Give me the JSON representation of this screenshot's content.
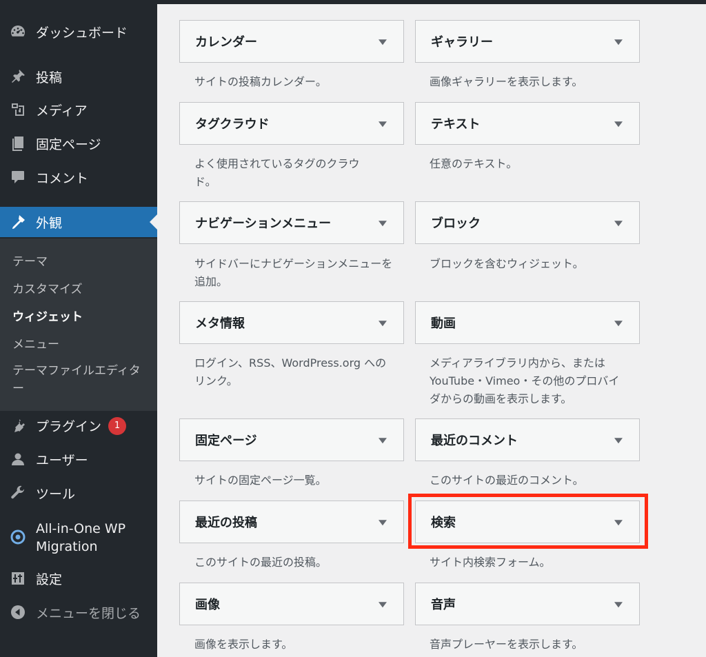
{
  "sidebar": {
    "items": [
      {
        "label": "ダッシュボード",
        "icon": "dashboard-icon"
      },
      {
        "label": "投稿",
        "icon": "pin-icon"
      },
      {
        "label": "メディア",
        "icon": "media-icon"
      },
      {
        "label": "固定ページ",
        "icon": "page-icon"
      },
      {
        "label": "コメント",
        "icon": "comment-icon"
      },
      {
        "label": "外観",
        "icon": "appearance-icon"
      },
      {
        "label": "プラグイン",
        "icon": "plugin-icon",
        "badge": "1"
      },
      {
        "label": "ユーザー",
        "icon": "user-icon"
      },
      {
        "label": "ツール",
        "icon": "wrench-icon"
      },
      {
        "label": "All-in-One WP Migration",
        "icon": "migration-icon"
      },
      {
        "label": "設定",
        "icon": "settings-icon"
      },
      {
        "label": "メニューを閉じる",
        "icon": "collapse-icon"
      }
    ],
    "submenu": [
      {
        "label": "テーマ"
      },
      {
        "label": "カスタマイズ"
      },
      {
        "label": "ウィジェット"
      },
      {
        "label": "メニュー"
      },
      {
        "label": "テーマファイルエディター"
      }
    ]
  },
  "widgets": [
    {
      "title": "カレンダー",
      "desc": "サイトの投稿カレンダー。"
    },
    {
      "title": "ギャラリー",
      "desc": "画像ギャラリーを表示します。"
    },
    {
      "title": "タグクラウド",
      "desc": "よく使用されているタグのクラウド。"
    },
    {
      "title": "テキスト",
      "desc": "任意のテキスト。"
    },
    {
      "title": "ナビゲーションメニュー",
      "desc": "サイドバーにナビゲーションメニューを追加。"
    },
    {
      "title": "ブロック",
      "desc": "ブロックを含むウィジェット。"
    },
    {
      "title": "メタ情報",
      "desc": "ログイン、RSS、WordPress.org へのリンク。"
    },
    {
      "title": "動画",
      "desc": "メディアライブラリ内から、または YouTube・Vimeo・その他のプロバイダからの動画を表示します。"
    },
    {
      "title": "固定ページ",
      "desc": "サイトの固定ページ一覧。"
    },
    {
      "title": "最近のコメント",
      "desc": "このサイトの最近のコメント。"
    },
    {
      "title": "最近の投稿",
      "desc": "このサイトの最近の投稿。"
    },
    {
      "title": "検索",
      "desc": "サイト内検索フォーム。"
    },
    {
      "title": "画像",
      "desc": "画像を表示します。"
    },
    {
      "title": "音声",
      "desc": "音声プレーヤーを表示します。"
    }
  ],
  "colors": {
    "sidebar_bg": "#23282d",
    "submenu_bg": "#32373c",
    "active": "#2271b1",
    "badge": "#d63638",
    "highlight": "#ff2a12"
  }
}
